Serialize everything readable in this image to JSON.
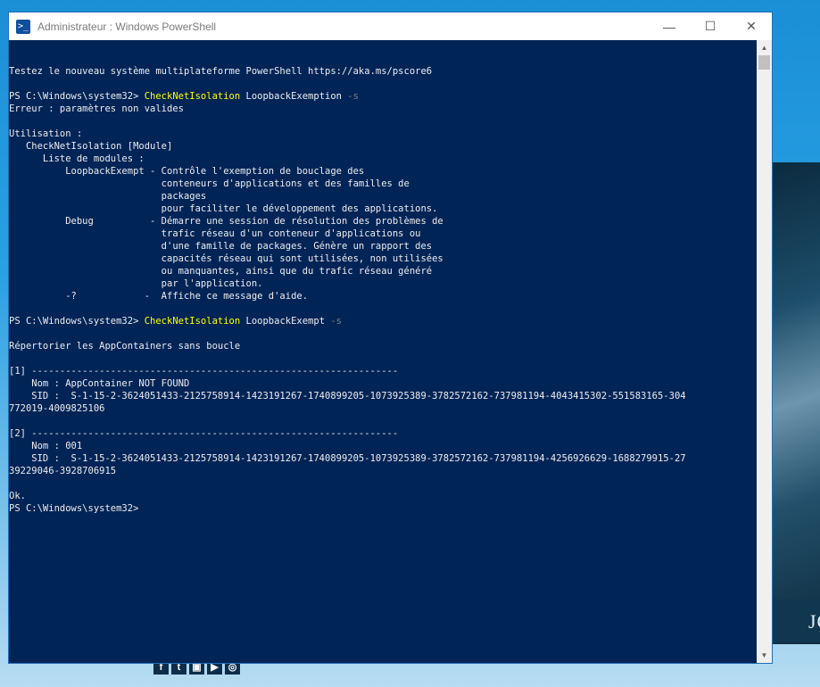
{
  "window": {
    "title": "Administrateur : Windows PowerShell",
    "icon": "powershell-icon",
    "controls": {
      "minimize": "—",
      "maximize": "☐",
      "close": "✕"
    }
  },
  "console": {
    "lines": [
      {
        "text": ""
      },
      {
        "text": "Testez le nouveau système multiplateforme PowerShell https://aka.ms/pscore6"
      },
      {
        "text": ""
      },
      {
        "prompt": "PS C:\\Windows\\system32> ",
        "cmd": "CheckNetIsolation",
        "arg": " LoopbackExemption ",
        "param": "-s"
      },
      {
        "text": "Erreur : paramètres non valides"
      },
      {
        "text": ""
      },
      {
        "text": "Utilisation :"
      },
      {
        "text": "   CheckNetIsolation [Module]"
      },
      {
        "text": "      Liste de modules :"
      },
      {
        "text": "          LoopbackExempt - Contrôle l'exemption de bouclage des"
      },
      {
        "text": "                           conteneurs d'applications et des familles de"
      },
      {
        "text": "                           packages"
      },
      {
        "text": "                           pour faciliter le développement des applications."
      },
      {
        "text": "          Debug          - Démarre une session de résolution des problèmes de"
      },
      {
        "text": "                           trafic réseau d'un conteneur d'applications ou"
      },
      {
        "text": "                           d'une famille de packages. Génère un rapport des"
      },
      {
        "text": "                           capacités réseau qui sont utilisées, non utilisées"
      },
      {
        "text": "                           ou manquantes, ainsi que du trafic réseau généré"
      },
      {
        "text": "                           par l'application."
      },
      {
        "text": "          -?            -  Affiche ce message d'aide."
      },
      {
        "text": ""
      },
      {
        "prompt": "PS C:\\Windows\\system32> ",
        "cmd": "CheckNetIsolation",
        "arg": " LoopbackExempt ",
        "param": "-s"
      },
      {
        "text": ""
      },
      {
        "text": "Répertorier les AppContainers sans boucle"
      },
      {
        "text": ""
      },
      {
        "text": "[1] -----------------------------------------------------------------"
      },
      {
        "text": "    Nom : AppContainer NOT FOUND"
      },
      {
        "text": "    SID :  S-1-15-2-3624051433-2125758914-1423191267-1740899205-1073925389-3782572162-737981194-4043415302-551583165-304"
      },
      {
        "text": "772019-4009825106"
      },
      {
        "text": ""
      },
      {
        "text": "[2] -----------------------------------------------------------------"
      },
      {
        "text": "    Nom : 001"
      },
      {
        "text": "    SID :  S-1-15-2-3624051433-2125758914-1423191267-1740899205-1073925389-3782572162-737981194-4256926629-1688279915-27"
      },
      {
        "text": "39229046-3928706915"
      },
      {
        "text": ""
      },
      {
        "text": "Ok."
      },
      {
        "text": "PS C:\\Windows\\system32>"
      }
    ]
  },
  "desktop": {
    "wallpaper_text": "JO",
    "social_icons": [
      "facebook-icon",
      "twitter-icon",
      "twitch-icon",
      "youtube-icon",
      "instagram-icon"
    ]
  },
  "colors": {
    "console_bg": "#012456",
    "console_fg": "#eeedf0",
    "command": "#ffff00",
    "parameter": "#7f7f7f"
  }
}
